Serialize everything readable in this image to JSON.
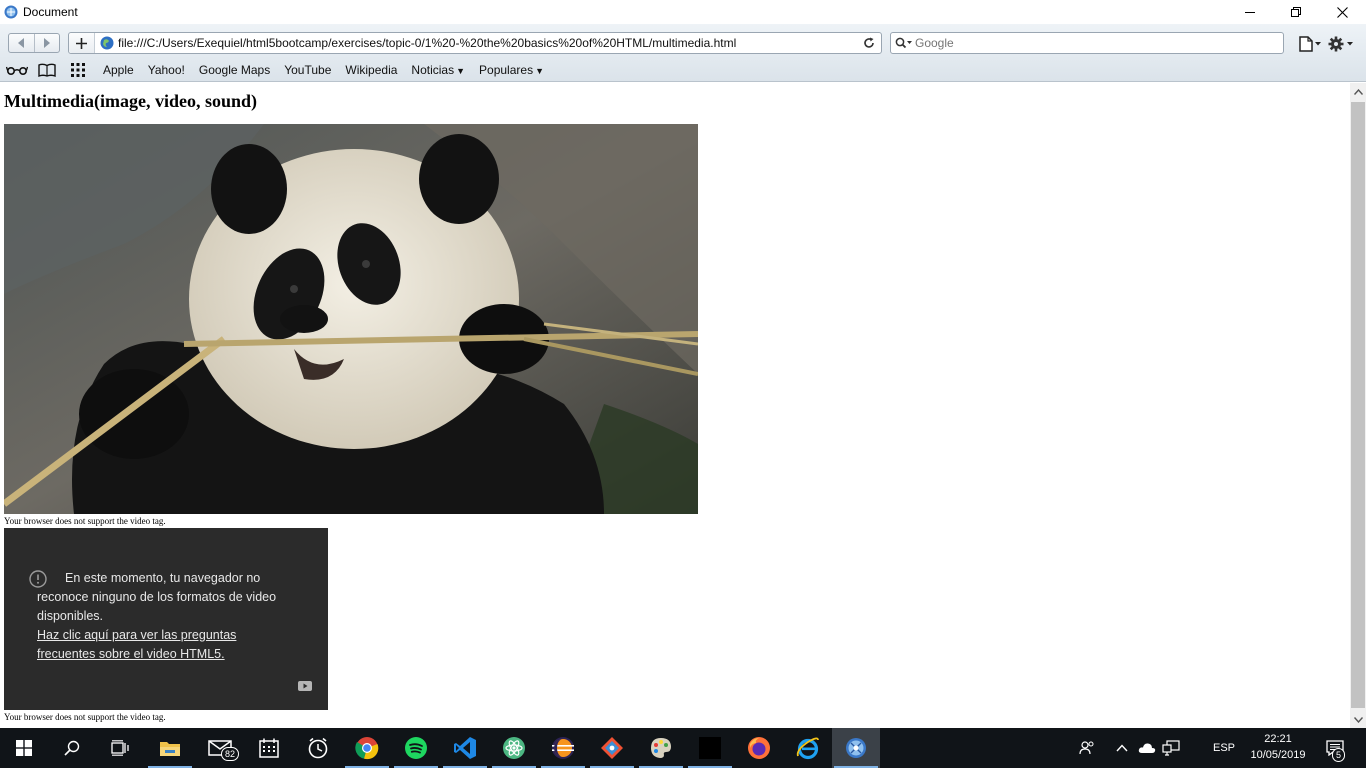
{
  "window": {
    "title": "Document"
  },
  "toolbar": {
    "url": "file:///C:/Users/Exequiel/html5bootcamp/exercises/topic-0/1%20-%20the%20basics%20of%20HTML/multimedia.html",
    "search_placeholder": "Google"
  },
  "bookmarks": {
    "items": [
      {
        "label": "Apple"
      },
      {
        "label": "Yahoo!"
      },
      {
        "label": "Google Maps"
      },
      {
        "label": "YouTube"
      },
      {
        "label": "Wikipedia"
      },
      {
        "label": "Noticias",
        "has_menu": true
      },
      {
        "label": "Populares",
        "has_menu": true
      }
    ]
  },
  "page": {
    "heading": "Multimedia(image, video, sound)",
    "image_alt": "Panda eating bamboo",
    "video_fallback_1": "Your browser does not support the video tag.",
    "video_message": "En este momento, tu navegador no reconoce ninguno de los formatos de video disponibles.",
    "video_link": "Haz clic aquí para ver las preguntas frecuentes sobre el video HTML5.",
    "video_fallback_2": "Your browser does not support the video tag."
  },
  "taskbar": {
    "mail_badge": "82",
    "language": "ESP",
    "time": "22:21",
    "date": "10/05/2019",
    "notifications_badge": "5"
  },
  "colors": {
    "taskbar_bg": "#101418",
    "video_bg": "#2b2b2b",
    "toolbar_bg": "#e2e9ef"
  }
}
